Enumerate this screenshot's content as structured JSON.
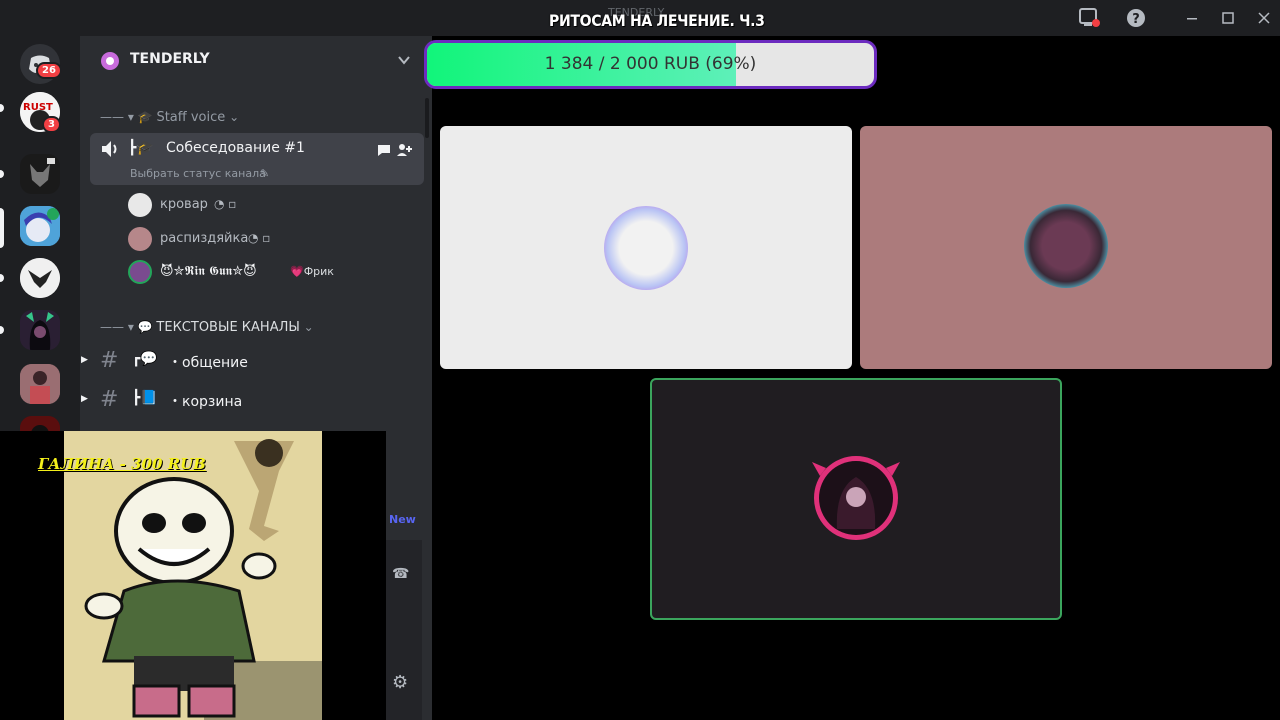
{
  "window": {
    "title": "РИТОСАМ НА ЛЕЧЕНИЕ. Ч.3",
    "subtitle": "TENDERLY"
  },
  "rail": {
    "servers": [
      {
        "name": "discord-home",
        "badge": "26"
      },
      {
        "name": "rust",
        "badge": "3",
        "logo_text": "RUST"
      },
      {
        "name": "wolf-server",
        "badge": ""
      },
      {
        "name": "anime-server",
        "badge": ""
      },
      {
        "name": "emblem-server",
        "badge": ""
      },
      {
        "name": "dark-anime-server",
        "badge": ""
      },
      {
        "name": "photo-server",
        "badge": ""
      },
      {
        "name": "red-server",
        "badge": ""
      }
    ]
  },
  "guild": {
    "name": "TENDERLY"
  },
  "voice": {
    "category": "Staff voice",
    "channel_name": "Собеседование #1",
    "channel_status": "Выбрать статус канала",
    "users": [
      {
        "name": "кровар"
      },
      {
        "name": "распиздяйка"
      },
      {
        "name": "😈✮𝕽𝖎𝖓 𝕲𝖚𝖓✮😈",
        "tag": "💗Фрик"
      }
    ]
  },
  "text": {
    "category": "ТЕКСТОВЫЕ КАНАЛЫ",
    "channels": [
      {
        "name": "・общение",
        "prefix": "┏💬"
      },
      {
        "name": "・корзина",
        "prefix": "┣📘"
      }
    ],
    "new_label": "New"
  },
  "overlay": {
    "donation_label": "ГАЛИНА - 300 RUB"
  },
  "donation": {
    "text": "1 384 / 2 000 RUB (69%)",
    "fraction": 0.692
  },
  "colors": {
    "progress_border": "#6c2bbf",
    "progress_fill": "#11f57a",
    "speaking_border": "#3ba55d",
    "badge": "#f23f43"
  }
}
